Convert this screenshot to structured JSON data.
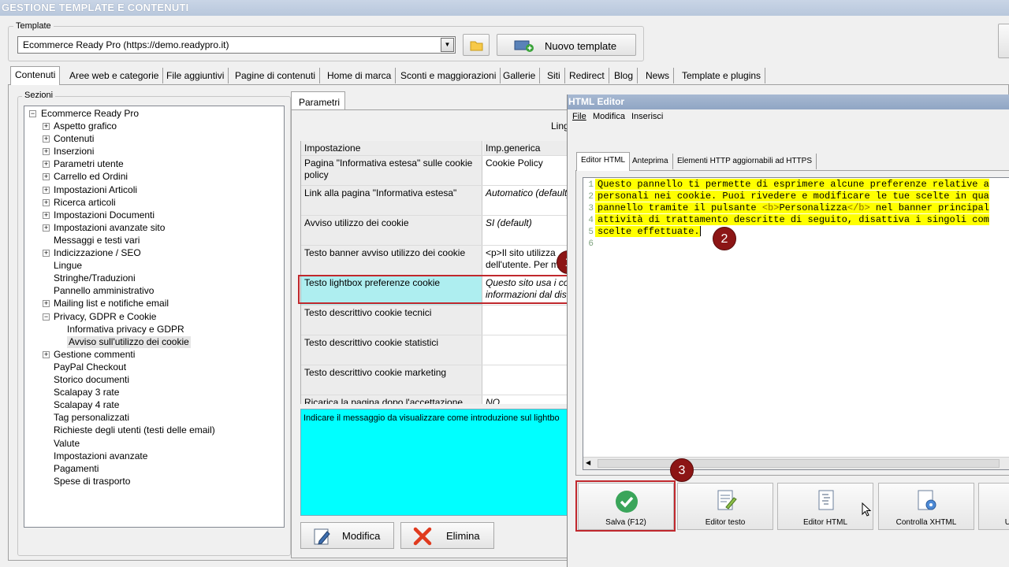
{
  "app": {
    "title": "GESTIONE TEMPLATE E CONTENUTI"
  },
  "template": {
    "group_label": "Template",
    "selected": "Ecommerce Ready Pro (https://demo.readypro.it)",
    "new_button": "Nuovo template"
  },
  "tabs": [
    {
      "label": "Contenuti",
      "active": true
    },
    {
      "label": "Aree web e categorie"
    },
    {
      "label": "File aggiuntivi"
    },
    {
      "label": "Pagine di contenuti"
    },
    {
      "label": "Home di marca"
    },
    {
      "label": "Sconti e maggiorazioni"
    },
    {
      "label": "Gallerie"
    },
    {
      "label": "Siti"
    },
    {
      "label": "Redirect"
    },
    {
      "label": "Blog"
    },
    {
      "label": "News"
    },
    {
      "label": "Template e plugins"
    }
  ],
  "sections": {
    "label": "Sezioni",
    "root": "Ecommerce Ready Pro",
    "items": [
      {
        "label": "Aspetto grafico",
        "expand": true
      },
      {
        "label": "Contenuti",
        "expand": true
      },
      {
        "label": "Inserzioni",
        "expand": true
      },
      {
        "label": "Parametri utente",
        "expand": true
      },
      {
        "label": "Carrello ed Ordini",
        "expand": true
      },
      {
        "label": "Impostazioni Articoli",
        "expand": true
      },
      {
        "label": "Ricerca articoli",
        "expand": true
      },
      {
        "label": "Impostazioni Documenti",
        "expand": true
      },
      {
        "label": "Impostazioni avanzate sito",
        "expand": true
      },
      {
        "label": "Messaggi e testi vari",
        "expand": false
      },
      {
        "label": "Indicizzazione / SEO",
        "expand": true
      },
      {
        "label": "Lingue",
        "expand": false
      },
      {
        "label": "Stringhe/Traduzioni",
        "expand": false
      },
      {
        "label": "Pannello amministrativo",
        "expand": false
      },
      {
        "label": "Mailing list e notifiche email",
        "expand": true
      },
      {
        "label": "Privacy, GDPR e Cookie",
        "expand": "open"
      },
      {
        "label": "Informativa privacy e GDPR",
        "child": true
      },
      {
        "label": "Avviso sull'utilizzo dei cookie",
        "child": true,
        "selected": true
      },
      {
        "label": "Gestione commenti",
        "expand": true
      },
      {
        "label": "PayPal Checkout",
        "expand": false
      },
      {
        "label": "Storico documenti",
        "expand": false
      },
      {
        "label": "Scalapay 3 rate",
        "expand": false
      },
      {
        "label": "Scalapay 4 rate",
        "expand": false
      },
      {
        "label": "Tag personalizzati",
        "expand": false
      },
      {
        "label": "Richieste degli utenti (testi delle email)",
        "expand": false
      },
      {
        "label": "Valute",
        "expand": false
      },
      {
        "label": "Impostazioni avanzate",
        "expand": false
      },
      {
        "label": "Pagamenti",
        "expand": false
      },
      {
        "label": "Spese di trasporto",
        "expand": false
      }
    ]
  },
  "params": {
    "tab": "Parametri",
    "lang_label": "Ling",
    "headers": [
      "Impostazione",
      "Imp.generica"
    ],
    "rows": [
      {
        "name": "Pagina \"Informativa estesa\" sulle cookie policy",
        "value": "Cookie Policy",
        "italic": false
      },
      {
        "name": "Link alla pagina \"Informativa estesa\"",
        "value": "Automatico (default)",
        "italic": true
      },
      {
        "name": "Avviso utilizzo dei cookie",
        "value": "SI (default)",
        "italic": true
      },
      {
        "name": "Testo banner avviso utilizzo dei cookie",
        "value": "<p>Il sito utilizza",
        "value2": "dell'utente. Per m",
        "italic": false
      },
      {
        "name": "Testo lightbox preferenze cookie",
        "value": "Questo sito usa i co",
        "value2": "informazioni dal dis",
        "italic": true,
        "selected": true
      },
      {
        "name": "Testo descrittivo cookie tecnici",
        "value": "",
        "italic": false
      },
      {
        "name": "Testo descrittivo cookie statistici",
        "value": "",
        "italic": false
      },
      {
        "name": "Testo descrittivo cookie marketing",
        "value": "",
        "italic": false
      },
      {
        "name": "Ricarica la pagina dopo l'accettazione",
        "value": "NO",
        "italic": true
      }
    ],
    "description": "Indicare il messaggio da visualizzare come introduzione sul lightbo",
    "modify_button": "Modifica",
    "delete_button": "Elimina"
  },
  "editor": {
    "title": "HTML Editor",
    "menu": [
      "File",
      "Modifica",
      "Inserisci"
    ],
    "tabs": [
      "Editor HTML",
      "Anteprima",
      "Elementi HTTP aggiornabili ad HTTPS"
    ],
    "lines": [
      {
        "n": "1",
        "text": "Questo pannello ti permette di esprimere alcune preferenze relative a"
      },
      {
        "n": "2",
        "text": "personali nei cookie. Puoi rivedere e modificare le tue scelte in qua"
      },
      {
        "n": "3",
        "pre": "pannello tramite il pulsante ",
        "tag1": "<b>",
        "mid": "Personalizza",
        "tag2": "</b>",
        "post": " nel banner principal"
      },
      {
        "n": "4",
        "text": "attività di trattamento descritte di seguito, disattiva i singoli com"
      },
      {
        "n": "5",
        "text": "scelte effettuate."
      },
      {
        "n": "6",
        "text": ""
      }
    ],
    "buttons": [
      "Salva (F12)",
      "Editor testo",
      "Editor HTML",
      "Controlla XHTML",
      "U"
    ]
  },
  "markers": [
    "1",
    "2",
    "3"
  ],
  "colors": {
    "highlight": "#ffff00",
    "description_bg": "#00ffff",
    "marker": "#8c1515",
    "selection": "#aeeef0"
  }
}
